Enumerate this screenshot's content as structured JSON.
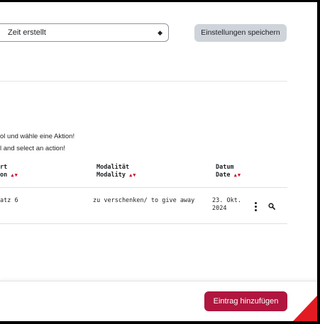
{
  "sort": {
    "selected": "Zeit erstellt"
  },
  "toolbar": {
    "save_label": "Einstellungen speichern"
  },
  "instructions": {
    "de": "ol und wähle eine Aktion!",
    "en": "l and select an action!"
  },
  "table": {
    "columns": [
      {
        "line1": "rt",
        "line2": "on",
        "arrows": "▲▼"
      },
      {
        "line1": "Modalität",
        "line2": "Modality",
        "arrows": "▲▼"
      },
      {
        "line1": "Datum",
        "line2": "Date",
        "arrows": "▲▼"
      }
    ],
    "rows": [
      {
        "place": "atz 6",
        "modality": "zu verschenken/ to give away",
        "date_line1": "23. Okt.",
        "date_line2": "2024"
      }
    ]
  },
  "footer": {
    "add_label": "Eintrag hinzufügen"
  },
  "colors": {
    "accent": "#b0163f",
    "sort_arrows": "#c8102e",
    "corner": "#e21b23"
  },
  "icons": {
    "row_menu": "kebab-icon",
    "row_view": "magnifier-icon"
  }
}
